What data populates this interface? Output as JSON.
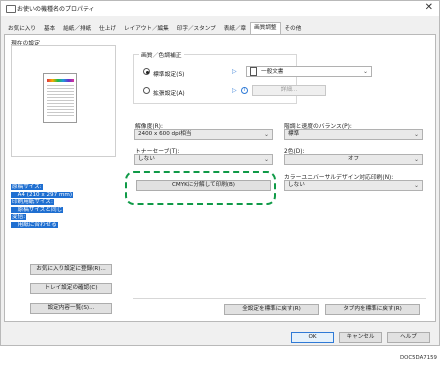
{
  "window": {
    "title": "お使いの機種名のプロパティ",
    "close_glyph": "✕"
  },
  "tabs": [
    {
      "label": "お気に入り"
    },
    {
      "label": "基本"
    },
    {
      "label": "給紙／排紙"
    },
    {
      "label": "仕上げ"
    },
    {
      "label": "レイアウト／編集"
    },
    {
      "label": "印字／スタンプ"
    },
    {
      "label": "表紙／章"
    },
    {
      "label": "画質調整"
    },
    {
      "label": "その他"
    }
  ],
  "left": {
    "current_settings_label": "現在の設定",
    "summary_lines": [
      "原稿サイズ:",
      "　A4 (210 x 297 mm)",
      "印刷用紙サイズ:",
      "　原稿サイズと同じ",
      "変倍:",
      "　用紙に合わせる"
    ],
    "buttons": {
      "register_favorite": "お気に入り設定に登録(R)...",
      "check_tray": "トレイ設定の確認(C)",
      "settings_list": "設定内容一覧(S)..."
    }
  },
  "image_group": {
    "title": "画質／色調補正",
    "standard_label": "標準設定(S)",
    "extended_label": "拡張設定(A)",
    "standard_value": "一般文書",
    "details_button": "詳細..."
  },
  "fields": {
    "resolution_label": "解像度(R):",
    "resolution_value": "2400 x 600 dpi相当",
    "gradation_label": "階調と速度のバランス(P):",
    "gradation_value": "標準",
    "toner_label": "トナーセーブ(T):",
    "toner_value": "しない",
    "twocolor_label": "2色(D):",
    "twocolor_value": "オフ",
    "universal_label": "カラーユニバーサルデザイン対応印刷(N):",
    "universal_value": "しない",
    "cmyk_button": "CMYKに分解して印刷(B)"
  },
  "reset_buttons": {
    "all_default": "全設定を標準に戻す(R)",
    "tab_default": "タブ内を標準に戻す(R)"
  },
  "dialog_buttons": {
    "ok": "OK",
    "cancel": "キャンセル",
    "help": "ヘルプ"
  },
  "figure_id": "DOC5DA7159",
  "colors": {
    "highlight": "#1f6fd1",
    "annotation": "#0f9a47",
    "accent": "#2f7ad6"
  }
}
